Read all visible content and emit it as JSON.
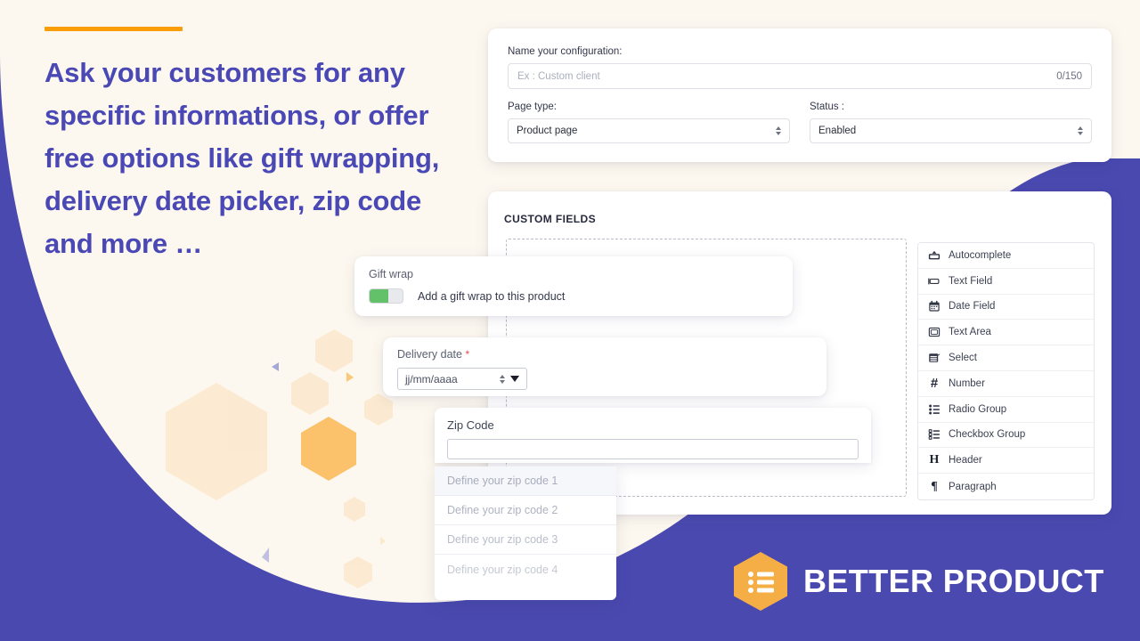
{
  "theme": {
    "purple": "#4A49B0",
    "cream": "#FDF8EF",
    "orange": "#F99D08",
    "heading_color": "#4A48B5",
    "toggle_on_color": "#63C169",
    "required_color": "#E5484D"
  },
  "hero": {
    "headline": "Ask your customers for any specific informations, or offer free options like gift wrapping, delivery date picker, zip code and more …"
  },
  "config_panel": {
    "name_label": "Name your configuration:",
    "name_placeholder": "Ex : Custom client",
    "char_counter": "0/150",
    "page_type_label": "Page type:",
    "page_type_value": "Product page",
    "status_label": "Status :",
    "status_value": "Enabled"
  },
  "fields_panel": {
    "title": "CUSTOM FIELDS",
    "field_types": [
      {
        "label": "Autocomplete",
        "icon": "autocomplete-icon"
      },
      {
        "label": "Text Field",
        "icon": "text-field-icon"
      },
      {
        "label": "Date Field",
        "icon": "calendar-icon"
      },
      {
        "label": "Text Area",
        "icon": "text-area-icon"
      },
      {
        "label": "Select",
        "icon": "select-icon"
      },
      {
        "label": "Number",
        "icon": "hash-icon"
      },
      {
        "label": "Radio Group",
        "icon": "radio-group-icon"
      },
      {
        "label": "Checkbox Group",
        "icon": "checkbox-group-icon"
      },
      {
        "label": "Header",
        "icon": "header-icon"
      },
      {
        "label": "Paragraph",
        "icon": "paragraph-icon"
      }
    ]
  },
  "gift_wrap": {
    "title": "Gift wrap",
    "description": "Add a gift wrap to this product",
    "toggle_state": "on"
  },
  "delivery_date": {
    "title": "Delivery date",
    "required_marker": "*",
    "date_placeholder": "jj/mm/aaaa"
  },
  "zip_code": {
    "title": "Zip Code",
    "input_value": "",
    "options": [
      "Define your zip code 1",
      "Define your zip code 2",
      "Define your zip code 3",
      "Define your zip code 4"
    ]
  },
  "logo": {
    "brand": "BETTER PRODUCT",
    "mark": "hexagon-list-icon"
  }
}
